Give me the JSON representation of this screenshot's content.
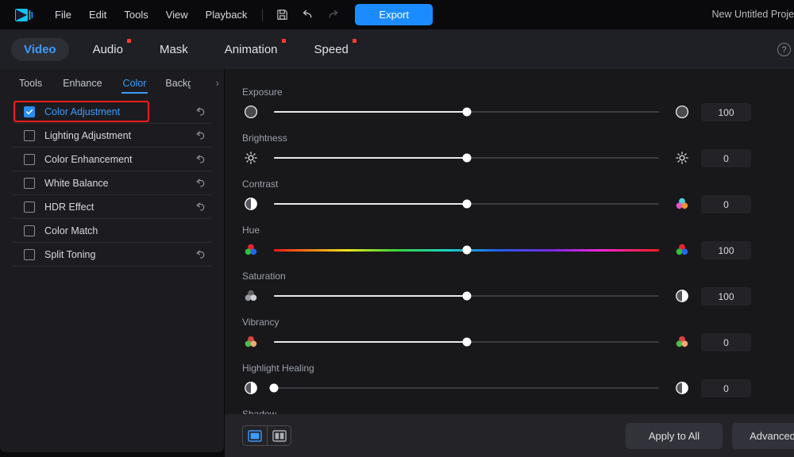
{
  "menubar": {
    "logo_icon": "app-logo-icon",
    "items": [
      "File",
      "Edit",
      "Tools",
      "View",
      "Playback"
    ],
    "save_icon": "save-icon",
    "undo_icon": "undo-icon",
    "redo_icon": "redo-icon",
    "export_label": "Export",
    "project_title": "New Untitled Proje"
  },
  "tabs": [
    {
      "label": "Video",
      "active": true,
      "badge": false
    },
    {
      "label": "Audio",
      "active": false,
      "badge": true
    },
    {
      "label": "Mask",
      "active": false,
      "badge": false
    },
    {
      "label": "Animation",
      "active": false,
      "badge": true
    },
    {
      "label": "Speed",
      "active": false,
      "badge": true
    }
  ],
  "help_icon_label": "?",
  "subtabs": [
    {
      "label": "Tools",
      "active": false
    },
    {
      "label": "Enhance",
      "active": false
    },
    {
      "label": "Color",
      "active": true
    },
    {
      "label": "Backg",
      "active": false
    }
  ],
  "subtab_more": "›",
  "effects": [
    {
      "label": "Color Adjustment",
      "checked": true,
      "selected": true,
      "reset": true
    },
    {
      "label": "Lighting Adjustment",
      "checked": false,
      "selected": false,
      "reset": true
    },
    {
      "label": "Color Enhancement",
      "checked": false,
      "selected": false,
      "reset": true
    },
    {
      "label": "White Balance",
      "checked": false,
      "selected": false,
      "reset": true
    },
    {
      "label": "HDR Effect",
      "checked": false,
      "selected": false,
      "reset": true
    },
    {
      "label": "Color Match",
      "checked": false,
      "selected": false,
      "reset": false
    },
    {
      "label": "Split Toning",
      "checked": false,
      "selected": false,
      "reset": true
    }
  ],
  "sliders": [
    {
      "label": "Exposure",
      "value": "100",
      "pct": 50,
      "rainbow": false,
      "left_icon": "exposure-circle-icon",
      "right_icon": "exposure-circle-icon"
    },
    {
      "label": "Brightness",
      "value": "0",
      "pct": 50,
      "rainbow": false,
      "left_icon": "brightness-sun-icon",
      "right_icon": "brightness-sun-icon"
    },
    {
      "label": "Contrast",
      "value": "0",
      "pct": 50,
      "rainbow": false,
      "left_icon": "contrast-half-circle-icon",
      "right_icon": "color-wheel-pastel-icon"
    },
    {
      "label": "Hue",
      "value": "100",
      "pct": 50,
      "rainbow": true,
      "left_icon": "hue-rgb-circles-icon",
      "right_icon": "hue-rgb-circles-icon"
    },
    {
      "label": "Saturation",
      "value": "100",
      "pct": 50,
      "rainbow": false,
      "left_icon": "saturation-gray-circles-icon",
      "right_icon": "contrast-half-circle-icon"
    },
    {
      "label": "Vibrancy",
      "value": "0",
      "pct": 50,
      "rainbow": false,
      "left_icon": "vibrancy-circles-icon",
      "right_icon": "vibrancy-circles-icon"
    },
    {
      "label": "Highlight Healing",
      "value": "0",
      "pct": 0,
      "rainbow": false,
      "left_icon": "highlight-half-circle-icon",
      "right_icon": "highlight-half-circle-icon"
    }
  ],
  "clipped_next_label": "Shadow",
  "bottombar": {
    "view_single_icon": "single-view-icon",
    "view_split_icon": "split-view-icon",
    "apply_all_label": "Apply to All",
    "advanced_label": "Advanced"
  },
  "colors": {
    "accent_blue": "#2a8cf0",
    "annotation_red": "#f51c1c",
    "panel_bg": "#18181b",
    "sidebar_bg": "#1c1c20"
  }
}
